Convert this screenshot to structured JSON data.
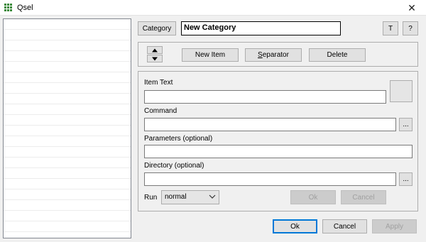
{
  "window": {
    "title": "Qsel",
    "close_glyph": "✕"
  },
  "category": {
    "button_label": "Category",
    "name_value": "New Category",
    "t_label": "T",
    "help_label": "?"
  },
  "toolbar": {
    "new_item_label": "New Item",
    "separator_label": "Separator",
    "separator_mnemonic_prefix": "S",
    "separator_mnemonic_rest": "eparator",
    "delete_label": "Delete"
  },
  "form": {
    "item_text_label": "Item Text",
    "item_text_value": "",
    "command_label": "Command",
    "command_value": "",
    "browse_label": "...",
    "parameters_label": "Parameters (optional)",
    "parameters_value": "",
    "directory_label": "Directory (optional)",
    "directory_value": "",
    "directory_browse_label": "...",
    "run_label": "Run",
    "run_selected": "normal",
    "ok_label": "Ok",
    "cancel_label": "Cancel"
  },
  "footer": {
    "ok_label": "Ok",
    "cancel_label": "Cancel",
    "apply_label": "Apply"
  },
  "icons": {
    "app": "grid-icon",
    "move_up": "arrow-up-icon",
    "move_down": "arrow-down-icon",
    "dropdown": "chevron-down-icon"
  },
  "colors": {
    "accent": "#0078d7",
    "app_icon": "#3a8a3a"
  }
}
